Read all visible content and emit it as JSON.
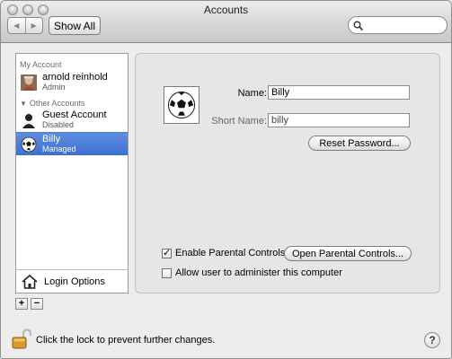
{
  "window": {
    "title": "Accounts"
  },
  "toolbar": {
    "back_glyph": "◀",
    "forward_glyph": "▶",
    "show_all_label": "Show All",
    "search_placeholder": ""
  },
  "sidebar": {
    "my_account_label": "My Account",
    "other_accounts_label": "Other Accounts",
    "disclosure_glyph": "▼",
    "accounts": [
      {
        "name": "arnold reinhold",
        "role": "Admin",
        "icon": "user-photo",
        "selected": false
      },
      {
        "name": "Guest Account",
        "role": "Disabled",
        "icon": "person-silhouette",
        "selected": false
      },
      {
        "name": "Billy",
        "role": "Managed",
        "icon": "soccer-ball",
        "selected": true
      }
    ],
    "login_options_label": "Login Options",
    "add_label": "+",
    "remove_label": "−"
  },
  "detail": {
    "name_label": "Name:",
    "name_value": "Billy",
    "short_name_label": "Short Name:",
    "short_name_value": "billy",
    "reset_password_label": "Reset Password...",
    "enable_parental_label": "Enable Parental Controls",
    "enable_parental_checked": true,
    "check_glyph": "✓",
    "open_parental_label": "Open Parental Controls...",
    "allow_admin_label": "Allow user to administer this computer",
    "allow_admin_checked": false
  },
  "footer": {
    "lock_text": "Click the lock to prevent further changes.",
    "help_label": "?"
  },
  "colors": {
    "selection": "#3d6fcf",
    "window_bg": "#ececec"
  }
}
